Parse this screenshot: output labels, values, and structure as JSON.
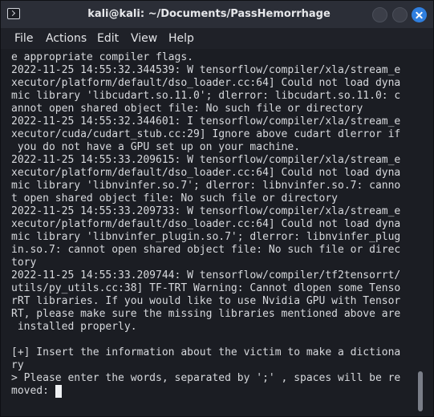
{
  "window": {
    "title": "kali@kali: ~/Documents/PassHemorrhage"
  },
  "icons": {
    "app": "terminal-icon",
    "minimize": "minimize-icon",
    "maximize": "maximize-icon",
    "close": "close-icon"
  },
  "colors": {
    "close_button": "#2f7fe0",
    "terminal_background": "#1b1d23",
    "terminal_text": "#d7d9dd"
  },
  "menu": [
    "File",
    "Actions",
    "Edit",
    "View",
    "Help"
  ],
  "terminal": {
    "lines": [
      "e appropriate compiler flags.",
      "2022-11-25 14:55:32.344539: W tensorflow/compiler/xla/stream_e",
      "xecutor/platform/default/dso_loader.cc:64] Could not load dyna",
      "mic library 'libcudart.so.11.0'; dlerror: libcudart.so.11.0: c",
      "annot open shared object file: No such file or directory",
      "2022-11-25 14:55:32.344601: I tensorflow/compiler/xla/stream_e",
      "xecutor/cuda/cudart_stub.cc:29] Ignore above cudart dlerror if",
      " you do not have a GPU set up on your machine.",
      "2022-11-25 14:55:33.209615: W tensorflow/compiler/xla/stream_e",
      "xecutor/platform/default/dso_loader.cc:64] Could not load dyna",
      "mic library 'libnvinfer.so.7'; dlerror: libnvinfer.so.7: canno",
      "t open shared object file: No such file or directory",
      "2022-11-25 14:55:33.209733: W tensorflow/compiler/xla/stream_e",
      "xecutor/platform/default/dso_loader.cc:64] Could not load dyna",
      "mic library 'libnvinfer_plugin.so.7'; dlerror: libnvinfer_plug",
      "in.so.7: cannot open shared object file: No such file or direc",
      "tory",
      "2022-11-25 14:55:33.209744: W tensorflow/compiler/tf2tensorrt/",
      "utils/py_utils.cc:38] TF-TRT Warning: Cannot dlopen some Tenso",
      "rRT libraries. If you would like to use Nvidia GPU with Tensor",
      "RT, please make sure the missing libraries mentioned above are",
      " installed properly.",
      "",
      "[+] Insert the information about the victim to make a dictiona",
      "ry",
      "> Please enter the words, separated by ';' , spaces will be re",
      "moved: "
    ]
  }
}
